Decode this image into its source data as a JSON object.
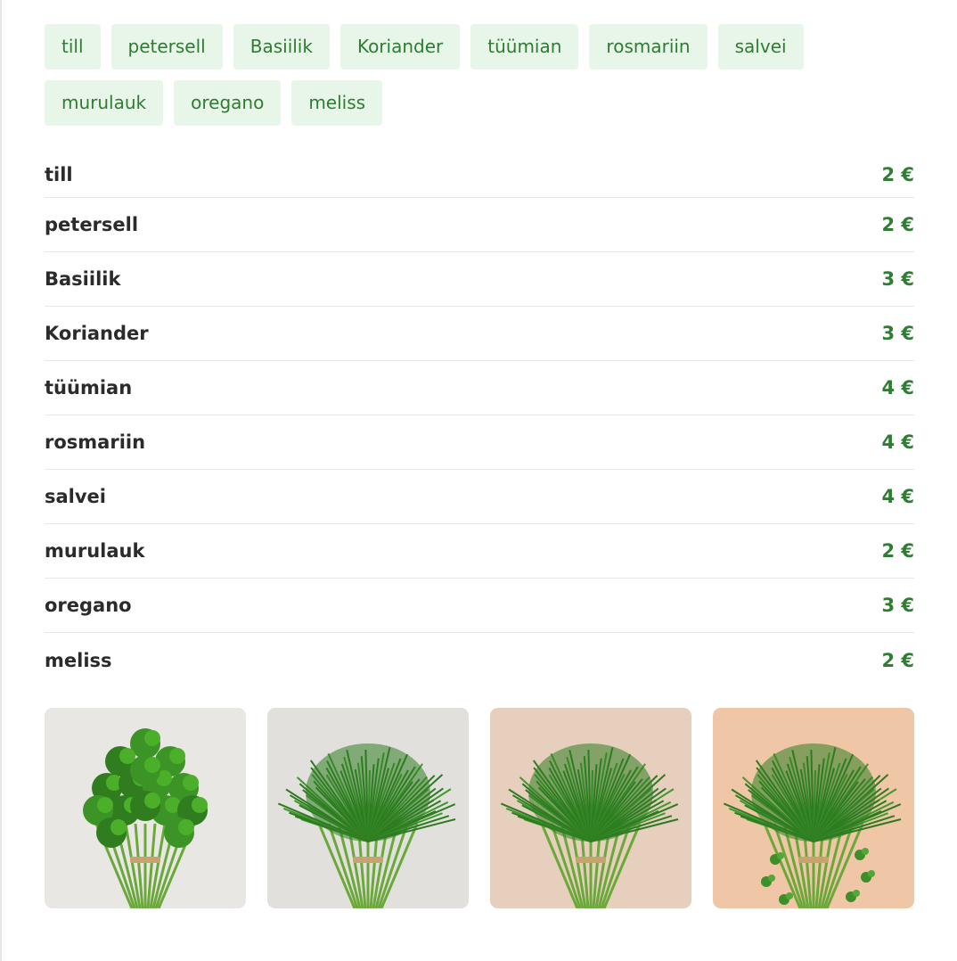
{
  "chips": [
    "till",
    "petersell",
    "Basiilik",
    "Koriander",
    "tüümian",
    "rosmariin",
    "salvei",
    "murulauk",
    "oregano",
    "meliss"
  ],
  "prices": [
    {
      "name": "till",
      "price": "2 €"
    },
    {
      "name": "petersell",
      "price": "2 €"
    },
    {
      "name": "Basiilik",
      "price": "3 €"
    },
    {
      "name": "Koriander",
      "price": "3 €"
    },
    {
      "name": "tüümian",
      "price": "4 €"
    },
    {
      "name": "rosmariin",
      "price": "4 €"
    },
    {
      "name": "salvei",
      "price": "4 €"
    },
    {
      "name": "murulauk",
      "price": "2 €"
    },
    {
      "name": "oregano",
      "price": "3 €"
    },
    {
      "name": "meliss",
      "price": "2 €"
    }
  ],
  "colors": {
    "chip_bg": "#e8f5e9",
    "accent": "#2e7d32",
    "text": "#2b2b2b"
  },
  "gallery": [
    {
      "icon": "parsley-bunch-image",
      "bg": "#e9e7e4",
      "herb": "parsley"
    },
    {
      "icon": "dill-bunch-image",
      "bg": "#e2e0dc",
      "herb": "dill"
    },
    {
      "icon": "dill-bunch-image",
      "bg": "#e6cfbd",
      "herb": "dill"
    },
    {
      "icon": "dill-bunch-image",
      "bg": "#efc6a6",
      "herb": "dill-sprigs"
    }
  ]
}
